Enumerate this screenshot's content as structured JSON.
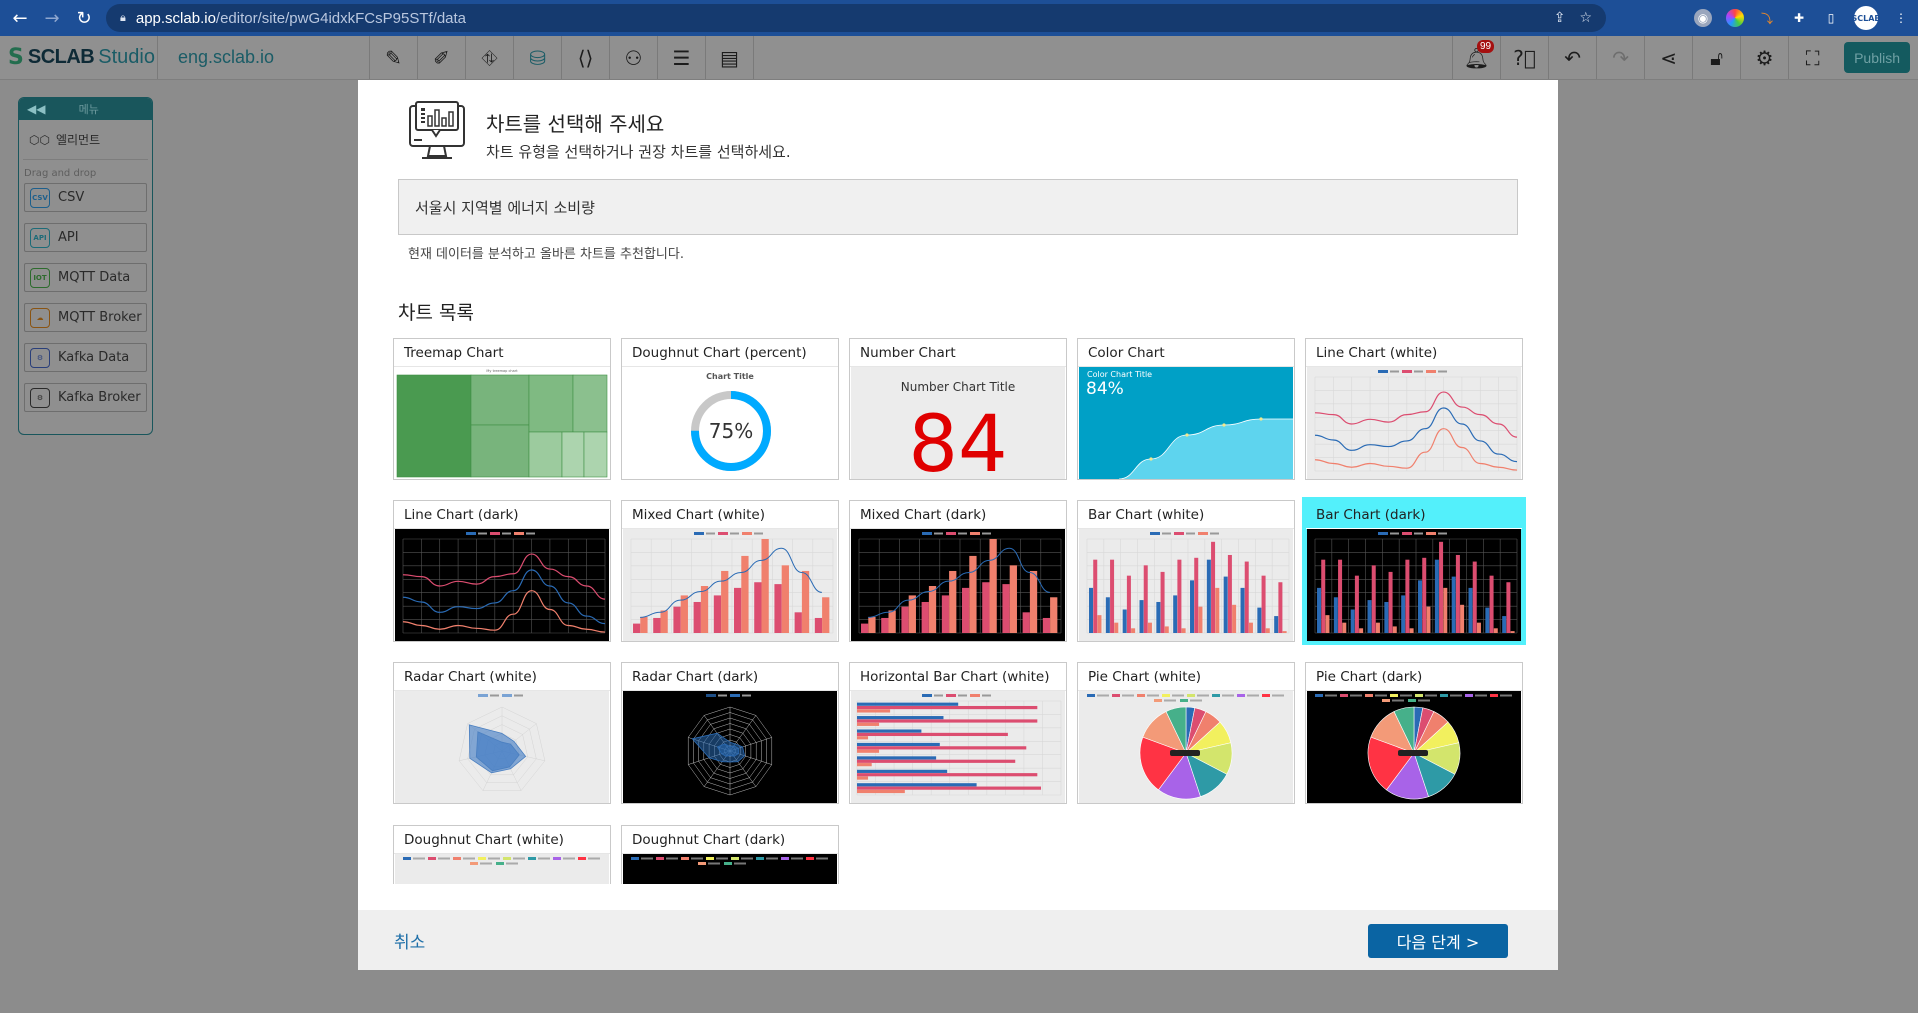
{
  "browser": {
    "url_host": "app.sclab.io",
    "url_path": "/editor/site/pwG4idxkFCsP95STf/data",
    "avatar_label": "SCLAB"
  },
  "app": {
    "logo_text": "SCLAB",
    "logo_sub": "Studio",
    "site_name": "eng.sclab.io",
    "tools": [
      {
        "icon": "desktop-edit-icon",
        "glyph": "✎"
      },
      {
        "icon": "mobile-edit-icon",
        "glyph": "✐"
      },
      {
        "icon": "map-icon",
        "glyph": "⛗"
      },
      {
        "icon": "database-icon",
        "glyph": "⛁",
        "active": true
      },
      {
        "icon": "code-icon",
        "glyph": "⟨⟩"
      },
      {
        "icon": "users-icon",
        "glyph": "⚇"
      },
      {
        "icon": "list-icon",
        "glyph": "☰"
      },
      {
        "icon": "card-icon",
        "glyph": "▤"
      }
    ],
    "notification_count": "99",
    "publish_label": "Publish"
  },
  "sidebar": {
    "title": "메뉴",
    "element_label": "엘리먼트",
    "caption": "Drag and drop",
    "items": [
      {
        "label": "CSV",
        "badge": "CSV",
        "color": "#1d5f8c"
      },
      {
        "label": "API",
        "badge": "API",
        "color": "#1d6b78"
      },
      {
        "label": "MQTT Data",
        "badge": "IOT",
        "color": "#2d6b2d"
      },
      {
        "label": "MQTT Broker",
        "badge": "☁",
        "color": "#8a5412"
      },
      {
        "label": "Kafka Data",
        "badge": "⚙",
        "color": "#2a3f7a"
      },
      {
        "label": "Kafka Broker",
        "badge": "⚙",
        "color": "#2a2a2a"
      }
    ]
  },
  "modal": {
    "title": "차트를 선택해 주세요",
    "subtitle": "차트 유형을 선택하거나 권장 차트를 선택하세요.",
    "data_name": "서울시 지역별 에너지 소비량",
    "recommend_note": "현재 데이터를 분석하고 올바른 차트를 추천합니다.",
    "list_title": "차트 목록",
    "cancel_label": "취소",
    "next_label": "다음 단계 >",
    "selected_chart": "Bar Chart (dark)",
    "charts": [
      {
        "label": "Treemap Chart",
        "kind": "treemap",
        "thumb_title": "My treemap chart"
      },
      {
        "label": "Doughnut Chart (percent)",
        "kind": "gauge",
        "thumb_title": "Chart Title",
        "value": "75%"
      },
      {
        "label": "Number Chart",
        "kind": "number",
        "thumb_title": "Number Chart Title",
        "value": "84"
      },
      {
        "label": "Color Chart",
        "kind": "color",
        "thumb_title": "Color Chart Title",
        "value": "84%"
      },
      {
        "label": "Line Chart (white)",
        "kind": "line",
        "theme": "white"
      },
      {
        "label": "Line Chart (dark)",
        "kind": "line",
        "theme": "dark"
      },
      {
        "label": "Mixed Chart (white)",
        "kind": "mixed",
        "theme": "white"
      },
      {
        "label": "Mixed Chart (dark)",
        "kind": "mixed",
        "theme": "dark"
      },
      {
        "label": "Bar Chart (white)",
        "kind": "bar",
        "theme": "white"
      },
      {
        "label": "Bar Chart (dark)",
        "kind": "bar",
        "theme": "dark",
        "selected": true
      },
      {
        "label": "Radar Chart (white)",
        "kind": "radar",
        "theme": "white"
      },
      {
        "label": "Radar Chart (dark)",
        "kind": "radar",
        "theme": "dark"
      },
      {
        "label": "Horizontal Bar Chart (white)",
        "kind": "hbar",
        "theme": "white"
      },
      {
        "label": "Pie Chart (white)",
        "kind": "pie",
        "theme": "white"
      },
      {
        "label": "Pie Chart (dark)",
        "kind": "pie",
        "theme": "dark"
      },
      {
        "label": "Doughnut Chart (white)",
        "kind": "doughnut",
        "theme": "white"
      },
      {
        "label": "Doughnut Chart (dark)",
        "kind": "doughnut",
        "theme": "dark"
      }
    ]
  },
  "thumb_series": {
    "line": [
      [
        0.62,
        0.6,
        0.5,
        0.55,
        0.52,
        0.6,
        0.63,
        0.84,
        0.68,
        0.6,
        0.5,
        0.36
      ],
      [
        0.38,
        0.33,
        0.22,
        0.28,
        0.26,
        0.32,
        0.45,
        0.67,
        0.5,
        0.32,
        0.18,
        0.1
      ],
      [
        0.12,
        0.08,
        0.04,
        0.08,
        0.05,
        0.03,
        0.2,
        0.45,
        0.25,
        0.08,
        0.04,
        0.01
      ]
    ],
    "bar": [
      [
        0.48,
        0.38,
        0.25,
        0.35,
        0.33,
        0.4,
        0.56,
        0.78,
        0.6,
        0.48,
        0.27,
        0.18
      ],
      [
        0.78,
        0.78,
        0.61,
        0.72,
        0.65,
        0.78,
        0.8,
        0.97,
        0.83,
        0.76,
        0.61,
        0.54
      ],
      [
        0.19,
        0.11,
        0.05,
        0.11,
        0.07,
        0.05,
        0.28,
        0.48,
        0.3,
        0.11,
        0.05,
        0.02
      ]
    ],
    "mixed_bars_a": [
      0.1,
      0.16,
      0.28,
      0.33,
      0.4,
      0.48,
      0.54,
      0.52,
      0.22,
      0.16
    ],
    "mixed_bars_b": [
      0.17,
      0.24,
      0.4,
      0.5,
      0.66,
      0.82,
      1.0,
      0.72,
      0.66,
      0.38
    ],
    "mixed_line": [
      0.18,
      0.24,
      0.38,
      0.48,
      0.6,
      0.7,
      0.84,
      0.98,
      0.7,
      0.47
    ],
    "hbar": [
      [
        0.55,
        0.47,
        0.35,
        0.45,
        0.43,
        0.49,
        0.65
      ],
      [
        0.98,
        0.98,
        0.82,
        0.92,
        0.86,
        0.98,
        1.0
      ],
      [
        0.18,
        0.12,
        0.06,
        0.12,
        0.08,
        0.06,
        0.26
      ]
    ],
    "pie": [
      3,
      4,
      6,
      8,
      11,
      12,
      15,
      20,
      12,
      7
    ],
    "treemap_shades": [
      "#4a9a50",
      "#78b47c",
      "#78b47c",
      "#7fba82",
      "#8bc08e",
      "#9ccb9e",
      "#acd4ae",
      "#acd4ae"
    ]
  },
  "colors": {
    "selected": "#53f0fb",
    "primary": "#0a64a3",
    "blue": "#2a6bb5",
    "red": "#dc4d70",
    "salmon": "#f0806d",
    "teal": "#00a0c6",
    "gauge": "#00aaff",
    "number": "#e00000",
    "pie": [
      "#2a6bb5",
      "#dc4d70",
      "#f0806d",
      "#f2f05e",
      "#d3e56c",
      "#2e9aa6",
      "#a863e8",
      "#ff3344",
      "#f39a78",
      "#46b08a"
    ]
  }
}
